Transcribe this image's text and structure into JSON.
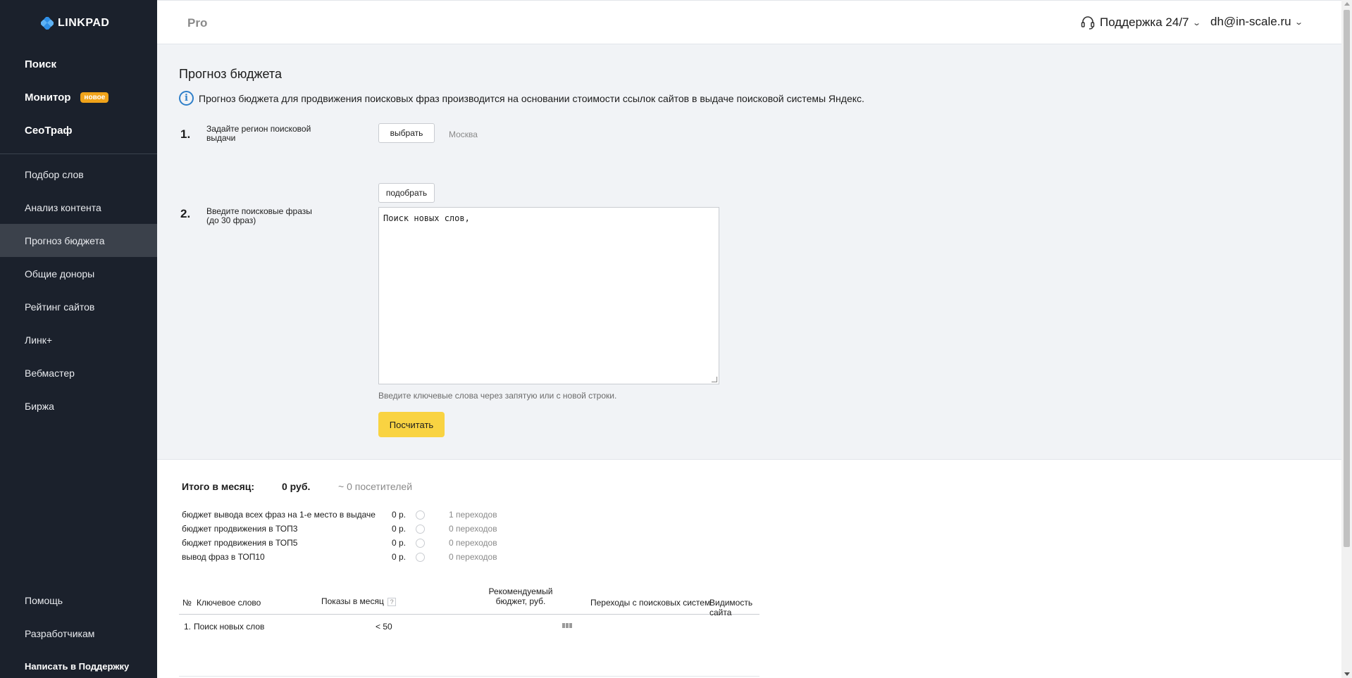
{
  "app": {
    "logo_text": "LINKPAD",
    "header_mode": "Pro",
    "support_label": "Поддержка 24/7",
    "user_email": "dh@in-scale.ru"
  },
  "sidebar": {
    "main": [
      {
        "label": "Поиск"
      },
      {
        "label": "Монитор",
        "badge": "новое"
      },
      {
        "label": "СеоТраф"
      }
    ],
    "tools": [
      {
        "label": "Подбор слов"
      },
      {
        "label": "Анализ контента"
      },
      {
        "label": "Прогноз бюджета",
        "active": true
      },
      {
        "label": "Общие доноры"
      },
      {
        "label": "Рейтинг сайтов"
      },
      {
        "label": "Линк+"
      },
      {
        "label": "Вебмастер"
      },
      {
        "label": "Биржа"
      }
    ],
    "bottom": [
      {
        "label": "Помощь"
      },
      {
        "label": "Разработчикам"
      },
      {
        "label": "Написать в Поддержку"
      }
    ]
  },
  "page": {
    "title": "Прогноз бюджета",
    "info": "Прогноз бюджета для продвижения поисковых фраз производится на основании стоимости ссылок сайтов в выдаче поисковой системы Яндекс.",
    "step1": {
      "num": "1.",
      "label": "Задайте регион поисковой выдачи",
      "button": "выбрать",
      "value": "Москва"
    },
    "step2": {
      "num": "2.",
      "label_line1": "Введите поисковые фразы",
      "label_line2": "(до 30 фраз)",
      "button": "подобрать",
      "textarea_value": "Поиск новых слов,"
    },
    "hint": "Введите ключевые слова через запятую или с новой строки.",
    "calc_button": "Посчитать"
  },
  "results": {
    "total_label": "Итого в месяц:",
    "total_sum": "0 руб.",
    "total_visitors": "~ 0 посетителей",
    "budgets": [
      {
        "name": "бюджет вывода всех фраз на 1-е место в выдаче",
        "value": "0 р.",
        "transitions": "1 переходов"
      },
      {
        "name": "бюджет продвижения в ТОП3",
        "value": "0 р.",
        "transitions": "0 переходов"
      },
      {
        "name": "бюджет продвижения в ТОП5",
        "value": "0 р.",
        "transitions": "0 переходов"
      },
      {
        "name": "вывод фраз в ТОП10",
        "value": "0 р.",
        "transitions": "0 переходов"
      }
    ],
    "table": {
      "headers": {
        "num": "№",
        "keyword": "Ключевое слово",
        "impressions": "Показы в месяц",
        "impressions_help": "?",
        "budget_line1": "Рекомендуемый",
        "budget_line2": "бюджет, руб.",
        "transitions": "Переходы с поисковых систем",
        "visibility": "Видимость сайта"
      },
      "rows": [
        {
          "num": "1.",
          "keyword": "Поиск новых слов",
          "impressions": "< 50"
        }
      ]
    }
  }
}
